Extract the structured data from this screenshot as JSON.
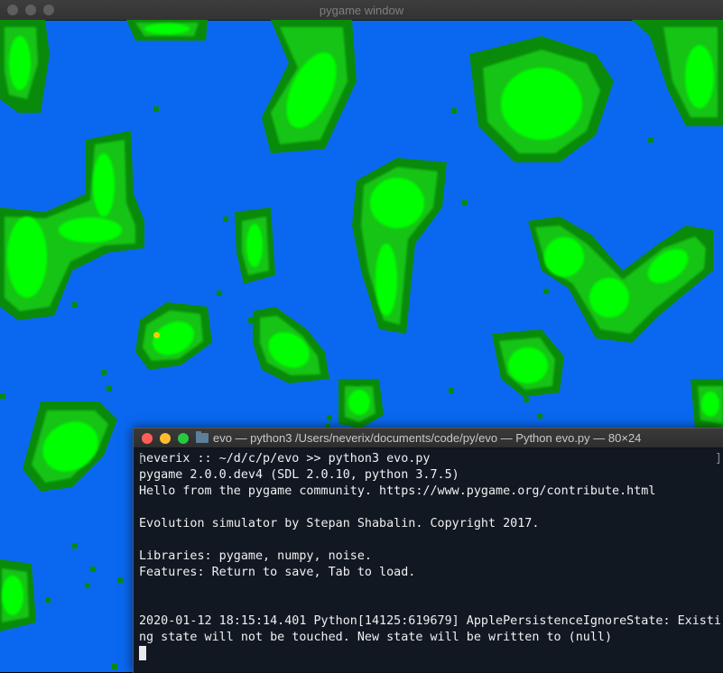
{
  "pygame_window": {
    "title": "pygame window",
    "colors": {
      "water": "#0a68f0",
      "land_dark": "#0a8a0a",
      "land": "#15c415",
      "land_bright": "#00ff00",
      "creature": "#f0d000"
    }
  },
  "terminal": {
    "title": "evo — python3 /Users/neverix/documents/code/py/evo — Python evo.py — 80×24",
    "lines": [
      "neverix :: ~/d/c/p/evo >> python3 evo.py",
      "pygame 2.0.0.dev4 (SDL 2.0.10, python 3.7.5)",
      "Hello from the pygame community. https://www.pygame.org/contribute.html",
      "",
      "Evolution simulator by Stepan Shabalin. Copyright 2017.",
      "",
      "Libraries: pygame, numpy, noise.",
      "Features: Return to save, Tab to load.",
      "",
      "",
      "2020-01-12 18:15:14.401 Python[14125:619679] ApplePersistenceIgnoreState: Existi",
      "ng state will not be touched. New state will be written to (null)"
    ],
    "prompt_bracket_left": "[",
    "prompt_bracket_right": "]"
  }
}
